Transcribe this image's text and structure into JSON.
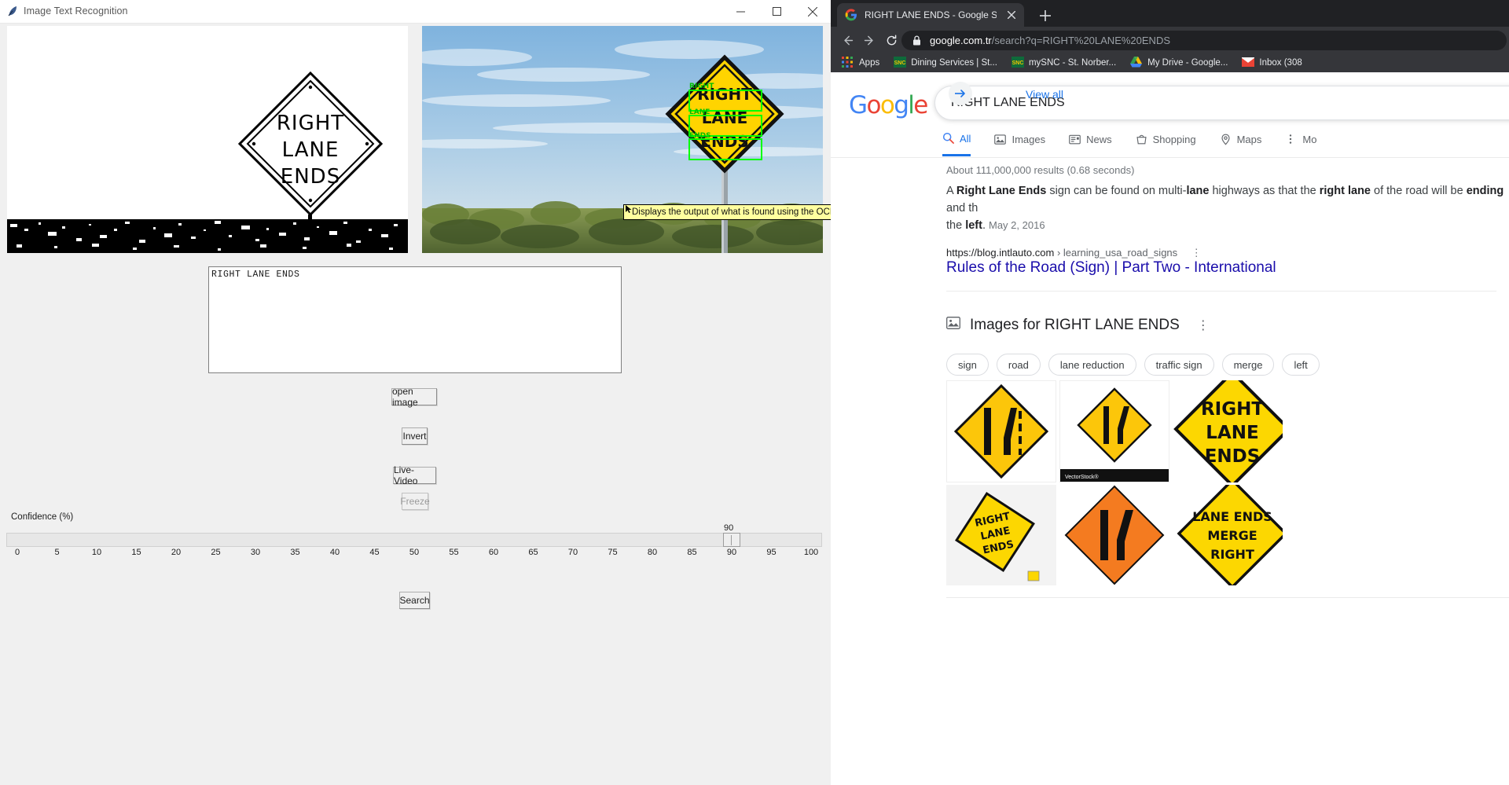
{
  "app": {
    "title": "Image Text Recognition",
    "title_icon": "feather-icon",
    "window_controls": {
      "minimize": "minimize-icon",
      "maximize": "maximize-icon",
      "close": "close-icon"
    },
    "left_image_alt": "binarized-road-sign-right-lane-ends",
    "right_image_alt": "photo-road-sign-right-lane-ends-with-ocr-boxes",
    "ocr_boxes": [
      "RIGHT",
      "LANE",
      "ENDS"
    ],
    "sign_lines": [
      "RIGHT",
      "LANE",
      "ENDS"
    ],
    "text_output": "RIGHT LANE ENDS",
    "buttons": {
      "open_image": "open image",
      "invert": "Invert",
      "live_video": "Live-Video",
      "freeze": "Freeze",
      "search": "Search"
    },
    "slider": {
      "label": "Confidence (%)",
      "value": "90",
      "min": 0,
      "max": 100,
      "ticks": [
        "0",
        "5",
        "10",
        "15",
        "20",
        "25",
        "30",
        "35",
        "40",
        "45",
        "50",
        "55",
        "60",
        "65",
        "70",
        "75",
        "80",
        "85",
        "90",
        "95",
        "100"
      ]
    },
    "tooltip": "Displays the output of what is found using the OCR algorithm with the results boxed on the original image."
  },
  "browser": {
    "tab": {
      "favicon": "google-favicon-icon",
      "title": "RIGHT LANE ENDS - Google Sear",
      "close": "close-icon"
    },
    "new_tab": "+",
    "nav": {
      "back": "back-arrow-icon",
      "forward": "forward-arrow-icon",
      "reload": "reload-icon"
    },
    "omnibox": {
      "lock": "lock-icon",
      "domain": "google.com.tr",
      "path": "/search?q=RIGHT%20LANE%20ENDS"
    },
    "bookmarks": [
      {
        "icon": "apps-grid-icon",
        "label": "Apps"
      },
      {
        "icon": "snc-icon",
        "label": "Dining Services | St..."
      },
      {
        "icon": "snc-icon",
        "label": "mySNC - St. Norber..."
      },
      {
        "icon": "drive-icon",
        "label": "My Drive - Google..."
      },
      {
        "icon": "gmail-icon",
        "label": "Inbox (308"
      }
    ]
  },
  "google": {
    "logo": "Google",
    "query": "RIGHT LANE ENDS",
    "tabs": [
      {
        "icon": "search-icon",
        "label": "All",
        "active": true
      },
      {
        "icon": "image-icon",
        "label": "Images",
        "active": false
      },
      {
        "icon": "news-icon",
        "label": "News",
        "active": false
      },
      {
        "icon": "shopping-icon",
        "label": "Shopping",
        "active": false
      },
      {
        "icon": "maps-pin-icon",
        "label": "Maps",
        "active": false
      },
      {
        "icon": "more-icon",
        "label": "Mo",
        "active": false
      }
    ],
    "result_stats": "About 111,000,000 results (0.68 seconds)",
    "featured_snippet": {
      "line1_a": "A ",
      "line1_b": "Right Lane Ends",
      "line1_c": " sign can be found on multi-",
      "line1_d": "lane",
      "line1_e": " highways a",
      "line2_a": "s that the ",
      "line2_b": "right lane",
      "line2_c": " of the road will be ",
      "line2_d": "ending",
      "line2_e": " and th",
      "line3_a": "the ",
      "line3_b": "left",
      "line3_c": ".",
      "date": "May 2, 2016"
    },
    "result_url_domain": "https://blog.intlauto.com",
    "result_url_crumb": "› learning_usa_road_signs",
    "result_url_menu": "three-dots-icon",
    "result_title": "Rules of the Road (Sign) | Part Two - International ",
    "about_label": "Abo",
    "images_section": {
      "icon": "image-results-icon",
      "title": "Images for RIGHT LANE ENDS",
      "menu": "three-dots-icon",
      "chips": [
        "sign",
        "road",
        "lane reduction",
        "traffic sign",
        "merge",
        "left"
      ],
      "thumbnails": [
        {
          "alt": "lane-reduction-sign-yellow-diamond",
          "lines": []
        },
        {
          "alt": "lane-ends-merge-sign-yellow-diamond",
          "lines": []
        },
        {
          "alt": "right-lane-ends-text-sign",
          "lines": [
            "RIGHT",
            "LANE",
            "ENDS"
          ]
        },
        {
          "alt": "right-lane-ends-small-sign",
          "lines": [
            "RIGHT",
            "LANE",
            "ENDS"
          ]
        },
        {
          "alt": "orange-lane-merge-construction-sign",
          "lines": []
        },
        {
          "alt": "lane-ends-merge-right-sign",
          "lines": [
            "LANE ENDS",
            "MERGE",
            "RIGHT"
          ]
        }
      ],
      "view_all": "View all",
      "view_all_icon": "arrow-right-icon"
    }
  },
  "colors": {
    "chrome_dark": "#35363a",
    "chrome_darker": "#202124",
    "google_blue": "#1a73e8",
    "link_blue": "#1a0dab",
    "sign_yellow": "#ffd400",
    "tooltip_yellow": "#ffff9f"
  }
}
